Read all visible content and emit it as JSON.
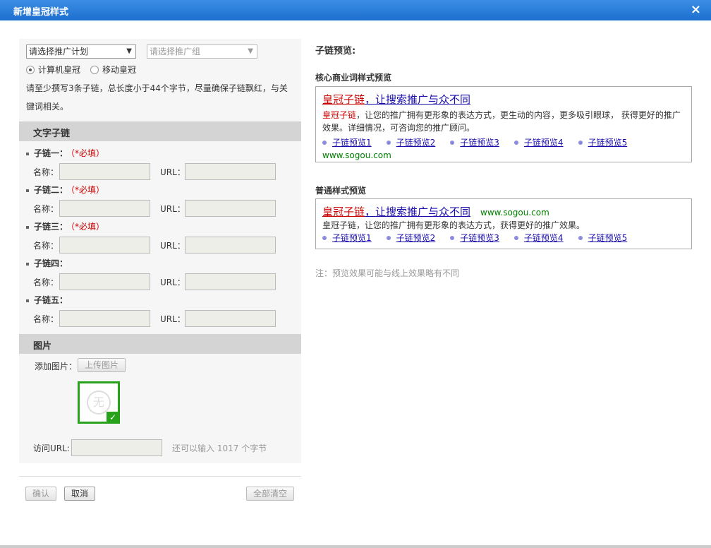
{
  "window": {
    "title": "新增皇冠样式",
    "close_icon": "×"
  },
  "form": {
    "plan_select": "请选择推广计划",
    "group_select": "请选择推广组",
    "radio_pc": "计算机皇冠",
    "radio_mobile": "移动皇冠",
    "hint": "请至少撰写3条子链，总长度小于44个字节，尽量确保子链飘红，与关键词相关。",
    "text_section": "文字子链",
    "name_label": "名称：",
    "url_label": "URL：",
    "required_tag": "（*必填）",
    "chains": [
      {
        "title": "子链一：",
        "required": true
      },
      {
        "title": "子链二：",
        "required": true
      },
      {
        "title": "子链三：",
        "required": true
      },
      {
        "title": "子链四：",
        "required": false
      },
      {
        "title": "子链五：",
        "required": false
      }
    ],
    "image_section": "图片",
    "add_image_label": "添加图片：",
    "upload_button": "上传图片",
    "no_image_glyph": "无",
    "visit_url_label": "访问URL:",
    "remaining_prefix": "还可以输入",
    "remaining_count": "1017",
    "remaining_suffix": "个字节",
    "confirm_button": "确认",
    "cancel_button": "取消",
    "clear_button": "全部清空"
  },
  "preview": {
    "heading": "子链预览:",
    "core_heading": "核心商业词样式预览",
    "normal_heading": "普通样式预览",
    "title_red": "皇冠子链",
    "title_blue": "，让搜索推广与众不同",
    "desc_red": "皇冠子链",
    "core_desc": "，让您的推广拥有更形象的表达方式，更生动的内容，更多吸引眼球， 获得更好的推广效果。详细情况，可咨询您的推广顾问。",
    "normal_desc": "皇冠子链，让您的推广拥有更形象的表达方式，获得更好的推广效果。",
    "links": [
      "子链预览1",
      "子链预览2",
      "子链预览3",
      "子链预览4",
      "子链预览5"
    ],
    "url": "www.sogou.com",
    "note": "注：预览效果可能与线上效果略有不同"
  }
}
